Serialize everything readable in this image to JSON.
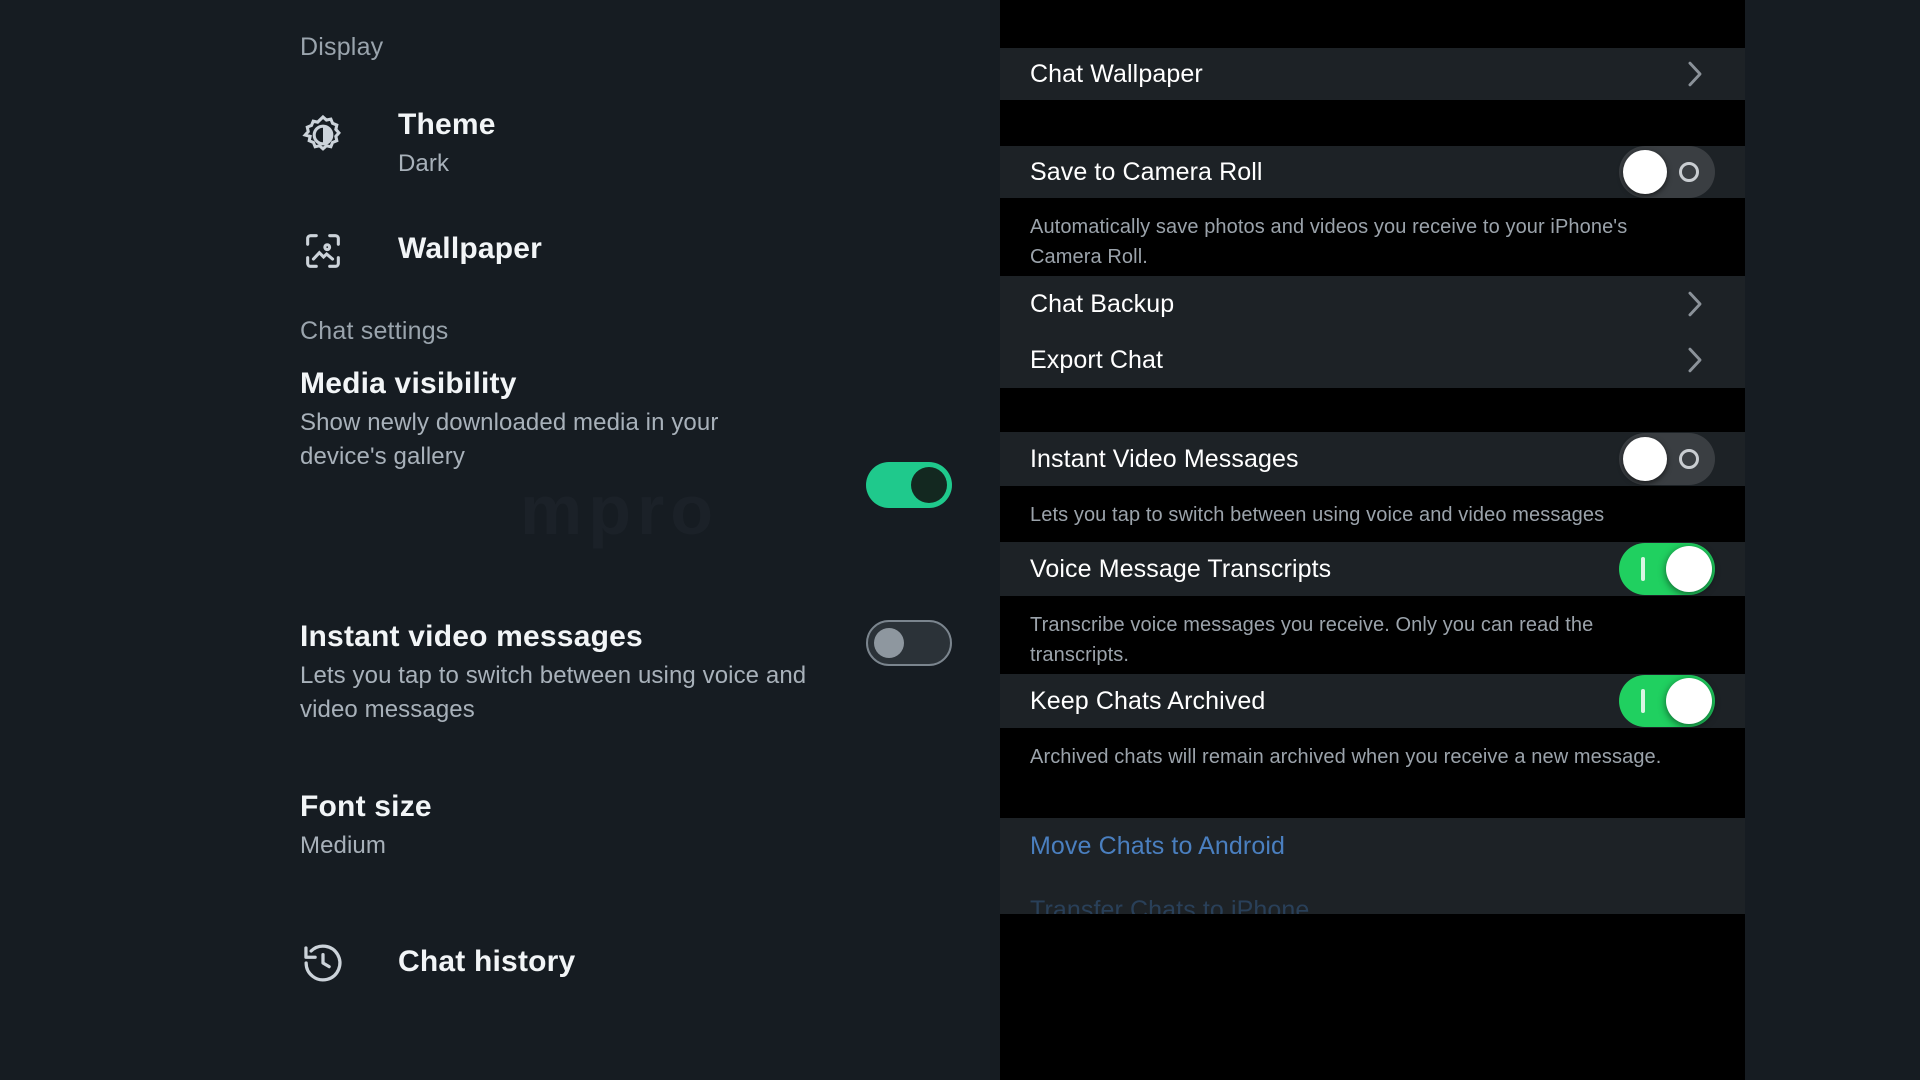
{
  "android": {
    "sections": [
      {
        "title": "Display"
      },
      {
        "title": "Chat settings"
      }
    ],
    "display": {
      "heading": "Display",
      "items": [
        {
          "icon": "brightness-icon",
          "title": "Theme",
          "value": "Dark"
        },
        {
          "icon": "wallpaper-icon",
          "title": "Wallpaper",
          "value": ""
        }
      ]
    },
    "chat_settings": {
      "heading": "Chat settings",
      "items": [
        {
          "title": "Media visibility",
          "subtitle": "Show newly downloaded media in your device's gallery",
          "toggle": "on"
        },
        {
          "title": "Instant video messages",
          "subtitle": "Lets you tap to switch between using voice and video messages",
          "toggle": "off"
        },
        {
          "title": "Font size",
          "subtitle": "Medium",
          "toggle": "none"
        }
      ],
      "chat_history": {
        "icon": "history-icon",
        "title": "Chat history"
      }
    }
  },
  "ios": {
    "rows": [
      {
        "label": "Chat Wallpaper",
        "accessory": "chevron"
      },
      {
        "label": "Save to Camera Roll",
        "accessory": "toggle-off",
        "note": "Automatically save photos and videos you receive to your iPhone's Camera Roll."
      },
      {
        "label": "Chat Backup",
        "accessory": "chevron"
      },
      {
        "label": "Export Chat",
        "accessory": "chevron"
      },
      {
        "label": "Instant Video Messages",
        "accessory": "toggle-off",
        "note": "Lets you tap to switch between using voice and video messages"
      },
      {
        "label": "Voice Message Transcripts",
        "accessory": "toggle-on",
        "note": "Transcribe voice messages you receive. Only you can read the transcripts."
      },
      {
        "label": "Keep Chats Archived",
        "accessory": "toggle-on",
        "note": "Archived chats will remain archived when you receive a new message."
      }
    ],
    "links": [
      {
        "label": "Move Chats to Android"
      },
      {
        "label": "Transfer Chats to iPhone"
      }
    ]
  },
  "colors": {
    "android_bg": "#161c22",
    "android_toggle_on": "#1fc98a",
    "ios_row_bg": "#1d2226",
    "ios_gap_bg": "#000000",
    "ios_toggle_on": "#20d060",
    "ios_link": "#4a7fbf"
  }
}
